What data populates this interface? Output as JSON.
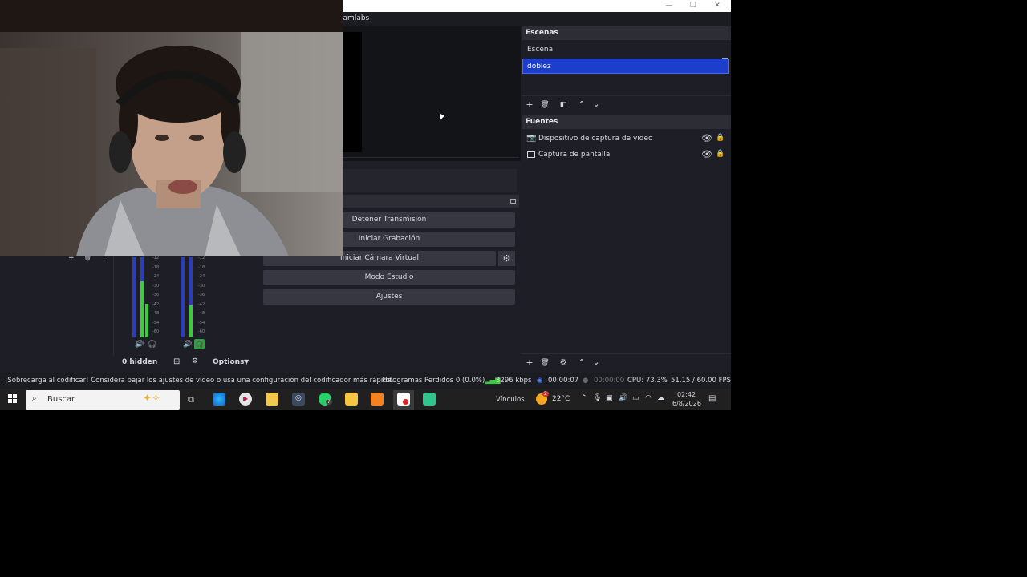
{
  "window": {
    "app_title_fragment": "eamlabs"
  },
  "scenes": {
    "header": "Escenas",
    "items": [
      "Escena",
      "doblez"
    ],
    "selected_index": 1
  },
  "sources": {
    "header": "Fuentes",
    "items": [
      "Dispositivo de captura de video",
      "Captura de pantalla"
    ]
  },
  "controls": {
    "stop_stream": "Detener Transmisión",
    "start_record": "Iniciar Grabación",
    "start_vcam": "Iniciar Cámara Virtual",
    "studio_mode": "Modo Estudio",
    "settings": "Ajustes"
  },
  "mixer": {
    "hidden_label": "0 hidden",
    "options_label": "Options",
    "ticks": [
      "-12",
      "-18",
      "-24",
      "-30",
      "-36",
      "-42",
      "-48",
      "-54",
      "-60"
    ]
  },
  "status": {
    "warning": "¡Sobrecarga al codificar! Considera bajar los ajustes de vídeo o usa una configuración del codificador más rápida.",
    "dropped": "Fotogramas Perdidos 0 (0.0%)",
    "bitrate": "3296 kbps",
    "stream_time": "00:00:07",
    "rec_time": "00:00:00",
    "cpu": "CPU: 73.3%",
    "fps": "51.15 / 60.00 FPS"
  },
  "taskbar": {
    "search_placeholder": "Buscar",
    "links": "Vínculos",
    "temp": "22°C",
    "weather_badge": "2",
    "whatsapp_badge": "7",
    "time": "02:42",
    "date": "6/8/2026"
  },
  "colors": {
    "accent": "#1d3dcc",
    "bg": "#1e1f26",
    "dock_header": "#2c2d35",
    "meter_blue": "#2c3dbb",
    "meter_green": "#3ccb3c"
  }
}
